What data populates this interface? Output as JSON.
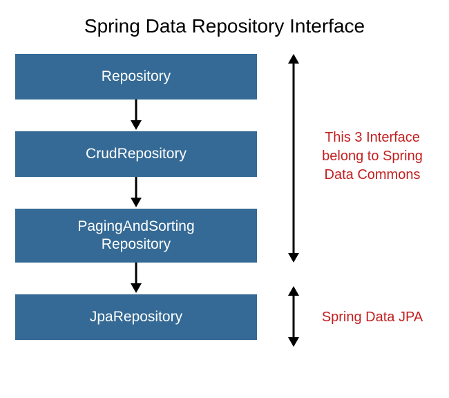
{
  "title": "Spring Data Repository Interface",
  "boxes": {
    "repository": "Repository",
    "crud": "CrudRepository",
    "paging_line1": "PagingAndSorting",
    "paging_line2": "Repository",
    "jpa": "JpaRepository"
  },
  "annotations": {
    "commons_line1": "This 3 Interface",
    "commons_line2": "belong to Spring",
    "commons_line3": "Data Commons",
    "jpa": "Spring Data JPA"
  },
  "colors": {
    "box_bg": "#346a95",
    "box_text": "#ffffff",
    "annotation": "#c21f1f"
  }
}
